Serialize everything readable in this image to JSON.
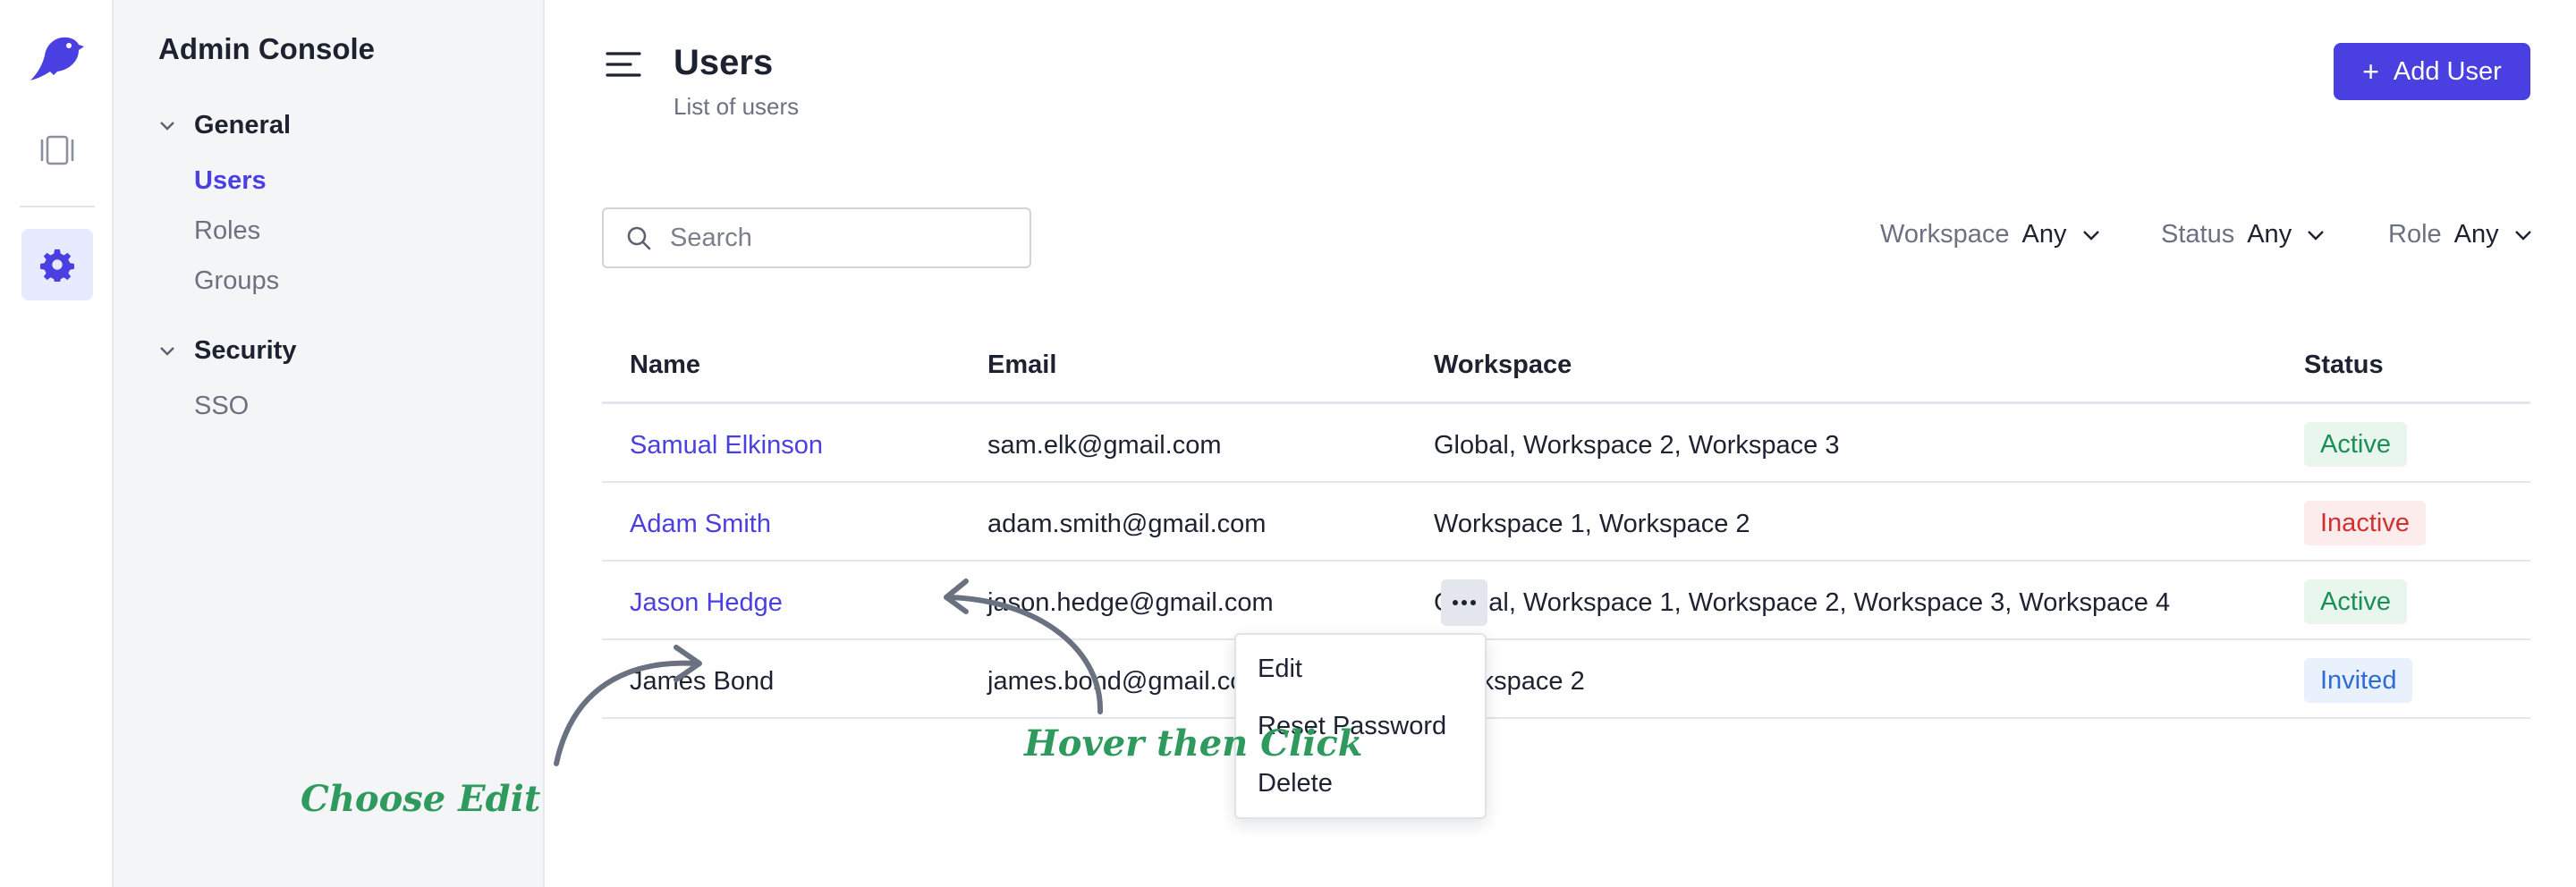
{
  "colors": {
    "accent": "#4a3fe0",
    "annotation": "#2f9a5e",
    "arrow": "#6a7282"
  },
  "rail": {
    "logo": "bird-logo-icon",
    "items": [
      {
        "icon": "docs-icon"
      },
      {
        "icon": "gear-icon",
        "active": true
      }
    ]
  },
  "sidebar": {
    "title": "Admin Console",
    "groups": [
      {
        "label": "General",
        "items": [
          "Users",
          "Roles",
          "Groups"
        ],
        "active": "Users"
      },
      {
        "label": "Security",
        "items": [
          "SSO"
        ]
      }
    ]
  },
  "header": {
    "title": "Users",
    "subtitle": "List of users",
    "add_label": "Add User"
  },
  "search": {
    "placeholder": "Search",
    "value": ""
  },
  "filters": [
    {
      "label": "Workspace",
      "value": "Any"
    },
    {
      "label": "Status",
      "value": "Any"
    },
    {
      "label": "Role",
      "value": "Any"
    }
  ],
  "table": {
    "columns": [
      "Name",
      "Email",
      "Workspace",
      "Status"
    ],
    "rows": [
      {
        "name": "Samual Elkinson",
        "email": "sam.elk@gmail.com",
        "workspace": "Global, Workspace 2, Workspace 3",
        "status": "Active"
      },
      {
        "name": "Adam Smith",
        "email": "adam.smith@gmail.com",
        "workspace": "Workspace 1, Workspace 2",
        "status": "Inactive"
      },
      {
        "name": "Jason Hedge",
        "email": "jason.hedge@gmail.com",
        "workspace": "Global, Workspace 1, Workspace 2, Workspace 3, Workspace 4",
        "status": "Active"
      },
      {
        "name": "James Bond",
        "email": "james.bond@gmail.com",
        "workspace": "Workspace 2",
        "status": "Invited"
      }
    ]
  },
  "row_menu": {
    "items": [
      "Edit",
      "Reset Password",
      "Delete"
    ]
  },
  "annotations": {
    "hover": "Hover then Click",
    "choose": "Choose Edit"
  }
}
